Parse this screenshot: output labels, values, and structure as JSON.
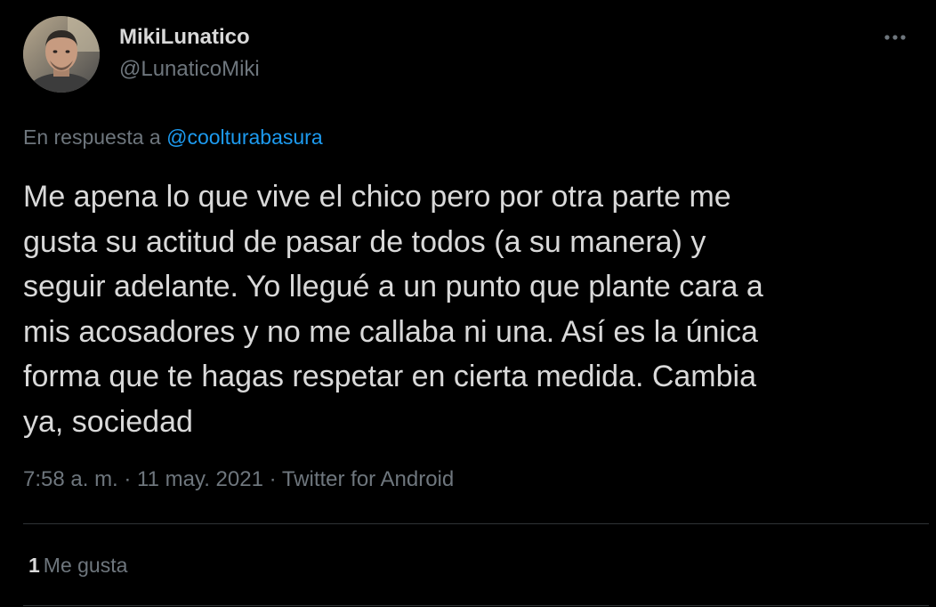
{
  "author": {
    "display_name": "MikiLunatico",
    "handle": "@LunaticoMiki",
    "avatar_icon": "avatar-photo"
  },
  "reply": {
    "prefix": "En respuesta a",
    "mention": "@coolturabasura"
  },
  "tweet_text": "Me apena lo que vive el chico pero por otra parte me\ngusta su actitud de pasar de todos (a su manera) y\nseguir adelante. Yo llegué a un punto que plante cara a\nmis acosadores y no me callaba ni una. Así es la única\nforma que te hagas respetar en cierta medida. Cambia\nya, sociedad",
  "meta": "7:58 a. m. · 11 may. 2021 · Twitter for Android",
  "likes": {
    "count": "1",
    "label": "Me gusta"
  },
  "more_icon": "more-horizontal-icon",
  "colors": {
    "background": "#000000",
    "text": "#d9d9d9",
    "secondary": "#6e767d",
    "link": "#1d9bf0",
    "divider": "#2f3336"
  }
}
